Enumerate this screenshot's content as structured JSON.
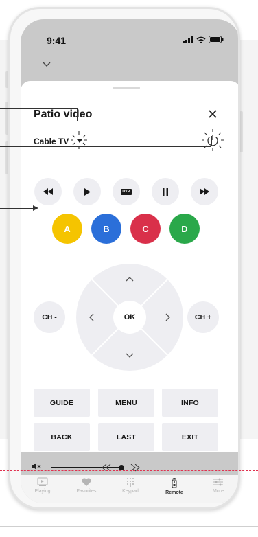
{
  "status": {
    "time": "9:41"
  },
  "sheet": {
    "title": "Patio video",
    "device": "Cable TV"
  },
  "transport": [
    {
      "name": "rewind-button",
      "icon": "rewind-icon"
    },
    {
      "name": "play-button",
      "icon": "play-icon"
    },
    {
      "name": "dvr-button",
      "icon": "dvr-icon",
      "label": "DVR"
    },
    {
      "name": "pause-button",
      "icon": "pause-icon"
    },
    {
      "name": "fast-forward-button",
      "icon": "fast-forward-icon"
    }
  ],
  "color_buttons": [
    {
      "label": "A",
      "color": "#f5c400"
    },
    {
      "label": "B",
      "color": "#2b6fd9"
    },
    {
      "label": "C",
      "color": "#d9304a"
    },
    {
      "label": "D",
      "color": "#2aa84a"
    }
  ],
  "dpad": {
    "ok_label": "OK"
  },
  "channel": {
    "down_label": "CH -",
    "up_label": "CH +"
  },
  "grid": {
    "guide": "GUIDE",
    "menu": "MENU",
    "info": "INFO",
    "back": "BACK",
    "last": "LAST",
    "exit": "EXIT"
  },
  "volume": {
    "level": 0.42
  },
  "tabs": [
    {
      "label": "Playing",
      "icon": "playing-icon",
      "active": false
    },
    {
      "label": "Favorites",
      "icon": "heart-icon",
      "active": false
    },
    {
      "label": "Keypad",
      "icon": "keypad-icon",
      "active": false
    },
    {
      "label": "Remote",
      "icon": "remote-icon",
      "active": true
    },
    {
      "label": "More",
      "icon": "more-icon",
      "active": false
    }
  ],
  "colors": {
    "annotation_dashed": "#e0314f",
    "sheet_button_bg": "#eeeef2"
  }
}
